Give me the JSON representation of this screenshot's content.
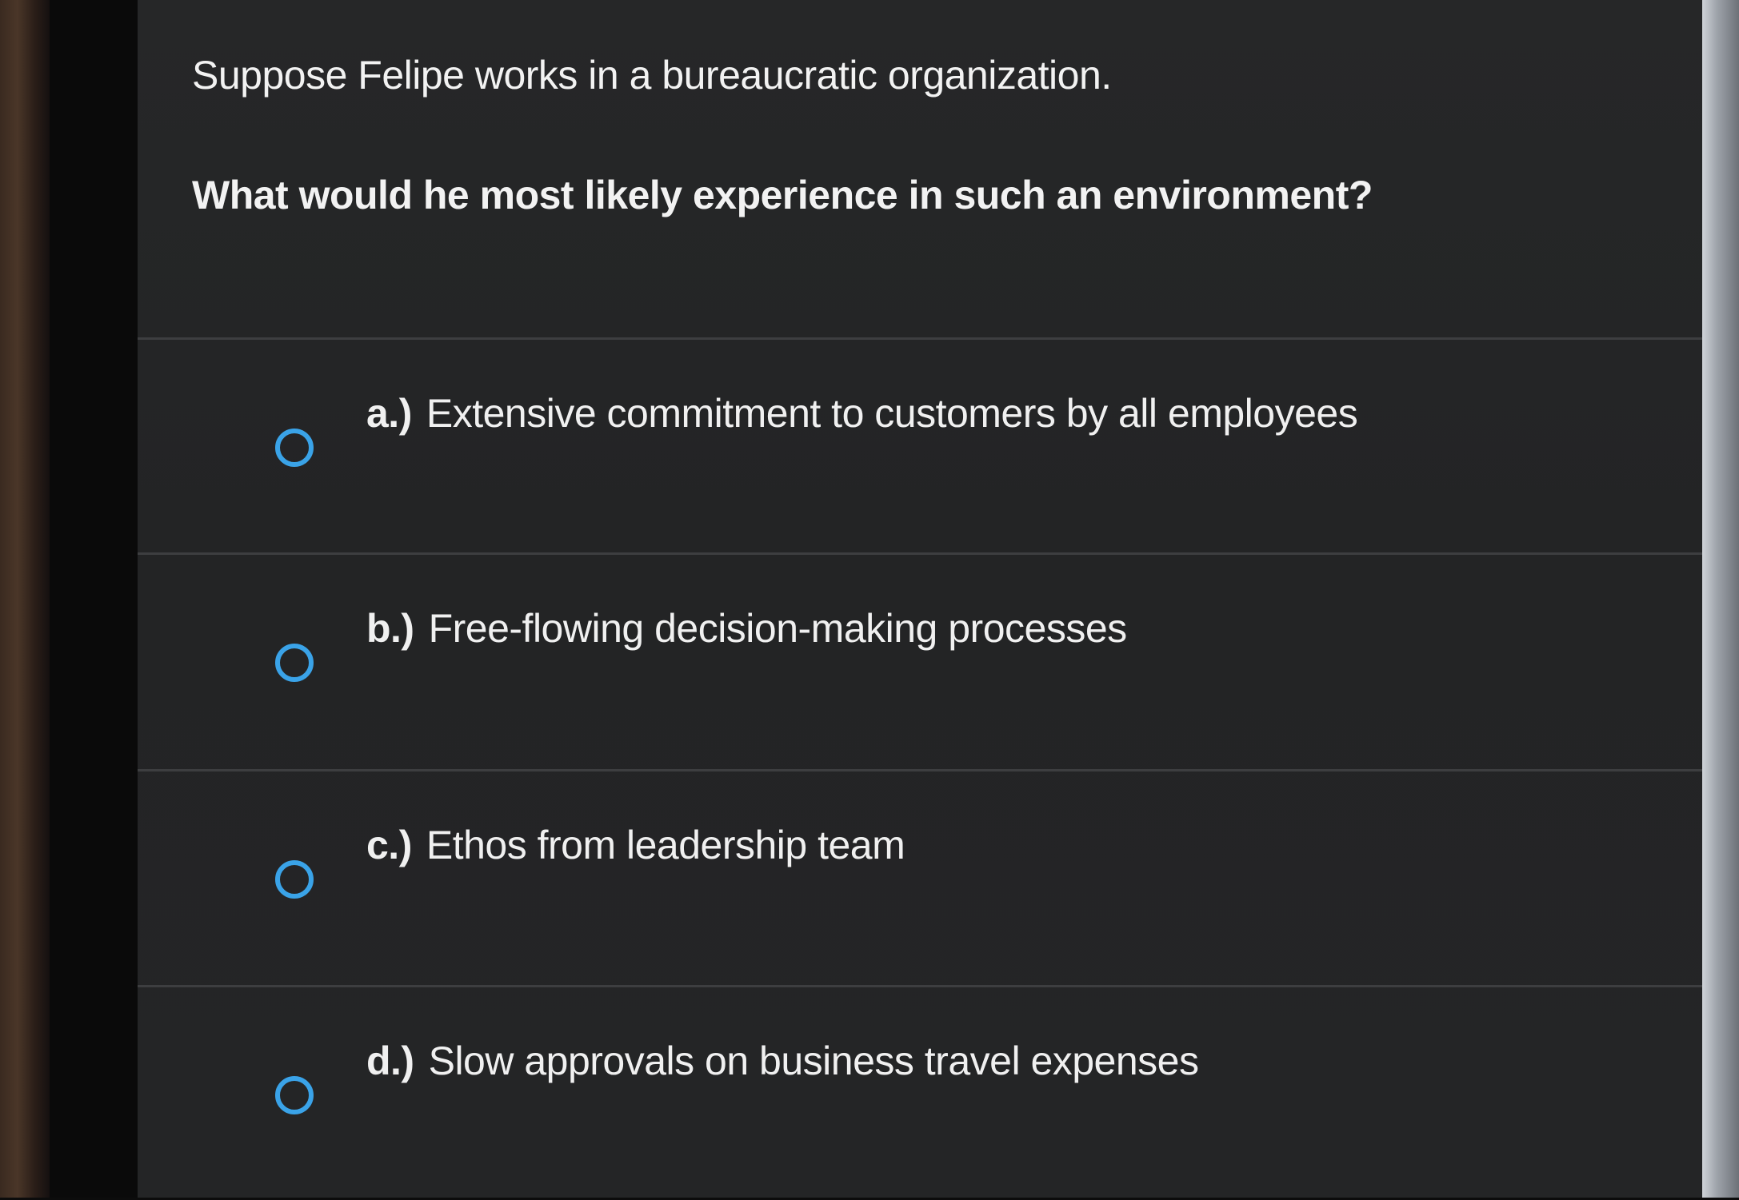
{
  "question": {
    "intro": "Suppose Felipe works in a bureaucratic organization.",
    "prompt": "What would he most likely experience in such an environment?"
  },
  "options": [
    {
      "letter": "a.)",
      "text": "Extensive commitment to customers by all employees",
      "selected": false
    },
    {
      "letter": "b.)",
      "text": "Free-flowing decision-making processes",
      "selected": false
    },
    {
      "letter": "c.)",
      "text": "Ethos from leadership team",
      "selected": false
    },
    {
      "letter": "d.)",
      "text": "Slow approvals on business travel expenses",
      "selected": false
    }
  ],
  "colors": {
    "background": "#242526",
    "radio_border": "#3aa3e8",
    "text": "#f0f0f0",
    "divider": "#3d3e40"
  }
}
